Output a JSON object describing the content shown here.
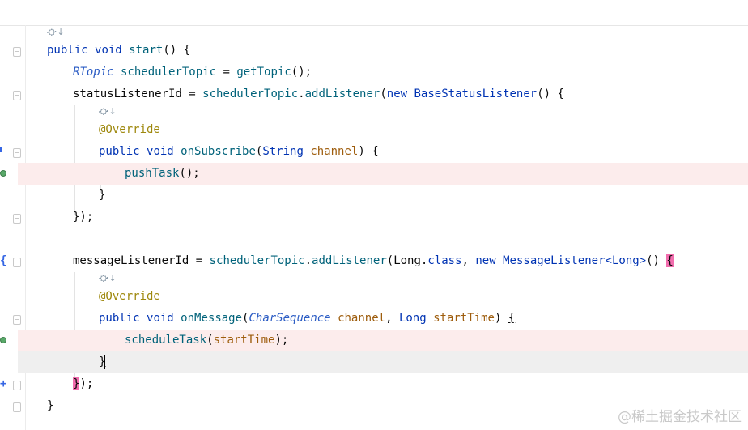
{
  "code": {
    "l1": [
      "public",
      " ",
      "void",
      " ",
      "start",
      "() {"
    ],
    "l2": [
      "RTopic",
      " ",
      "schedulerTopic",
      " = ",
      "getTopic",
      "();"
    ],
    "l3": [
      "statusListenerId",
      " = ",
      "schedulerTopic",
      ".",
      "addListener",
      "(",
      "new",
      " ",
      "BaseStatusListener",
      "() {"
    ],
    "l4": [
      "@Override"
    ],
    "l5": [
      "public",
      " ",
      "void",
      " ",
      "onSubscribe",
      "(",
      "String",
      " ",
      "channel",
      ") {"
    ],
    "l6": [
      "pushTask",
      "();"
    ],
    "l7": [
      "}"
    ],
    "l8": [
      "});"
    ],
    "l9": [
      "messageListenerId",
      " = ",
      "schedulerTopic",
      ".",
      "addListener",
      "(",
      "Long",
      ".",
      "class",
      ", ",
      "new",
      " ",
      "MessageListener<Long>",
      "() ",
      "{"
    ],
    "l10": [
      "@Override"
    ],
    "l11": [
      "public",
      " ",
      "void",
      " ",
      "onMessage",
      "(",
      "CharSequence",
      " ",
      "channel",
      ", ",
      "Long",
      " ",
      "startTime",
      ") ",
      "{"
    ],
    "l12": [
      "scheduleTask",
      "(",
      "startTime",
      ");"
    ],
    "l13": [
      "}"
    ],
    "l14": [
      "}",
      ");"
    ],
    "l15": [
      "}"
    ]
  },
  "icons": {
    "impl": "implementation-arrow-icon",
    "run": "run-gutter-icon"
  },
  "watermark": "@稀土掘金技术社区",
  "colors": {
    "keyword": "#0033b3",
    "method": "#00627a",
    "annotation": "#9e880d",
    "field": "#871094",
    "current_line": "#efefef",
    "highlight_line": "#fcecec",
    "brace_match": "#f26dae"
  }
}
